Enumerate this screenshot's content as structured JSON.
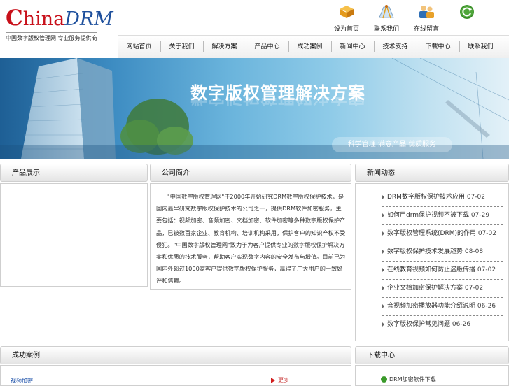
{
  "brand": {
    "c": "C",
    "hina": "hina",
    "drm": "DRM",
    "tagline": "中国数字版权管理网 专业服务提供商"
  },
  "top_links": [
    {
      "label": "设为首页",
      "icon": "book-icon"
    },
    {
      "label": "联系我们",
      "icon": "map-compass-icon"
    },
    {
      "label": "在线留言",
      "icon": "people-icon"
    },
    {
      "label": "",
      "icon": "refresh-icon"
    }
  ],
  "nav": [
    "网站首页",
    "关于我们",
    "解决方案",
    "产品中心",
    "成功案例",
    "新闻中心",
    "技术支持",
    "下载中心",
    "联系我们"
  ],
  "banner": {
    "title": "数字版权管理解决方案",
    "slogan": "科学管理 满意产品 优质服务"
  },
  "panels": {
    "left_title": "产品展示",
    "about_title": "公司简介",
    "news_title": "新闻动态",
    "bottom_left_title": "成功案例",
    "bottom_right_title": "下载中心"
  },
  "about_text": "\"中国数字版权管理网\"于2000年开始研究DRM数字版权保护技术，是国内最早研究数字版权保护技术的公司之一，提供DRM软件加密服务，主要包括：视频加密、音频加密、文档加密、软件加密等多种数字版权保护产品，已被数百家企业、教育机构、培训机构采用，保护客户的知识产权不受侵犯。\"中国数字版权管理网\"致力于为客户提供专业的数字版权保护解决方案和优质的技术服务，帮助客户实现数字内容的安全发布与增值。目前已为国内外超过1000家客户提供数字版权保护服务，赢得了广大用户的一致好评和信赖。",
  "news": [
    {
      "title": "DRM数字版权保护技术应用",
      "date": "07-02"
    },
    {
      "title": "如何用drm保护视频不被下载",
      "date": "07-29"
    },
    {
      "title": "数字版权管理系统(DRM)的作用",
      "date": "07-02"
    },
    {
      "title": "数字版权保护技术发展趋势",
      "date": "08-08"
    },
    {
      "title": "在线教育视频如何防止盗版传播",
      "date": "07-02"
    },
    {
      "title": "企业文档加密保护解决方案",
      "date": "07-02"
    },
    {
      "title": "音视频加密播放器功能介绍说明",
      "date": "06-26"
    },
    {
      "title": "数字版权保护常见问题",
      "date": "06-26"
    }
  ],
  "bottom": {
    "left_item": "视频加密",
    "mid_item": "更多",
    "right_item": "DRM加密软件下载"
  },
  "colors": {
    "brand_red": "#c8101a",
    "brand_blue": "#1d4f9c",
    "link_blue": "#1a4fa8"
  }
}
